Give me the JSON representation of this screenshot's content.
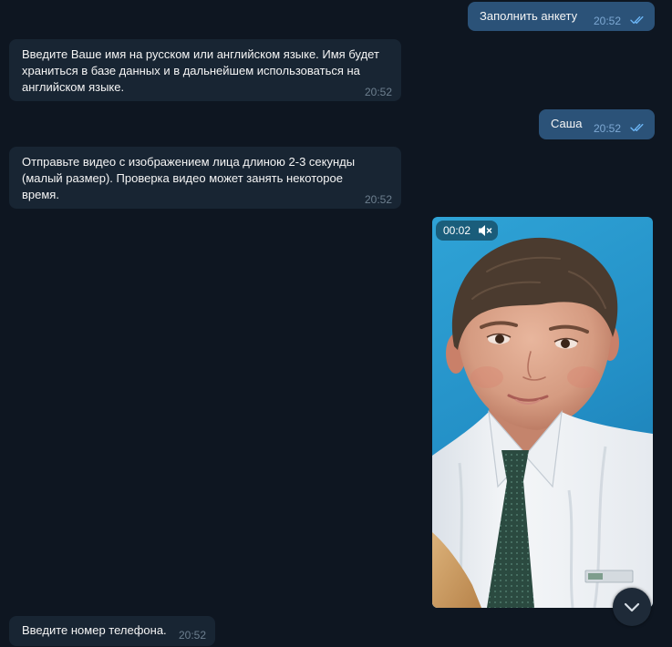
{
  "colors": {
    "background": "#0e1621",
    "outgoing_bubble": "#2b5278",
    "incoming_bubble": "#182533",
    "text": "#f5f5f5",
    "time_incoming": "#6d7f8f",
    "time_outgoing": "#7da8d3",
    "read_checks": "#6ab3f3",
    "scroll_button": "#1e2a38"
  },
  "messages": [
    {
      "text": "Заполнить анкету",
      "time": "20:52",
      "status_icon": "double-check-icon"
    },
    {
      "lines": [
        "Введите Ваше имя на русском или английском языке. Имя будет",
        "храниться в базе данных и в дальнейшем использоваться на",
        "английском языке."
      ],
      "time": "20:52"
    },
    {
      "text": "Саша",
      "time": "20:52",
      "status_icon": "double-check-icon"
    },
    {
      "lines": [
        "Отправьте видео с изображением лица длиною 2-3 секунды",
        "(малый размер). Проверка видео может занять некоторое",
        "время."
      ],
      "time": "20:52"
    },
    {
      "video": {
        "duration": "00:02",
        "muted": true,
        "sound_icon": "speaker-muted-icon"
      }
    },
    {
      "text": "Введите номер телефона.",
      "time": "20:52"
    }
  ],
  "scroll_button": {
    "icon": "chevron-down-icon"
  }
}
